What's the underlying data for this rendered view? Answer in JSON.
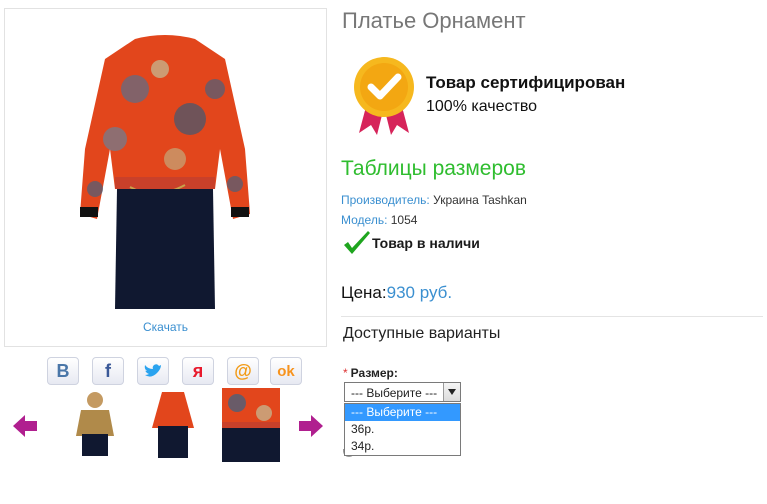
{
  "product": {
    "title": "Платье Орнамент",
    "download_label": "Скачать"
  },
  "certificate": {
    "title": "Товар сертифицирован",
    "subtitle": "100% качество"
  },
  "size_tables_link": "Таблицы размеров",
  "manufacturer": {
    "label": "Производитель:",
    "value": "Украина Tashkan"
  },
  "model": {
    "label": "Модель:",
    "value": "1054"
  },
  "stock": "Товар в наличи",
  "price": {
    "label": "Цена:",
    "value": "930 руб."
  },
  "variants_title": "Доступные варианты",
  "size_field": {
    "required_mark": "*",
    "label": "Размер:",
    "selected": "--- Выберите ---",
    "options": [
      "--- Выберите ---",
      "36р.",
      "34р."
    ]
  },
  "social": [
    {
      "name": "vk-icon",
      "glyph": "B",
      "color": "#4a76a8"
    },
    {
      "name": "facebook-icon",
      "glyph": "f",
      "color": "#3b5998"
    },
    {
      "name": "twitter-icon",
      "glyph": "🐦",
      "color": "#2aa3ef"
    },
    {
      "name": "moimir-icon",
      "glyph": "я",
      "color": "#e8192c"
    },
    {
      "name": "mail-icon",
      "glyph": "@",
      "color": "#f29b17"
    },
    {
      "name": "odnoklassniki-icon",
      "glyph": "ok",
      "color": "#f7931e"
    }
  ]
}
